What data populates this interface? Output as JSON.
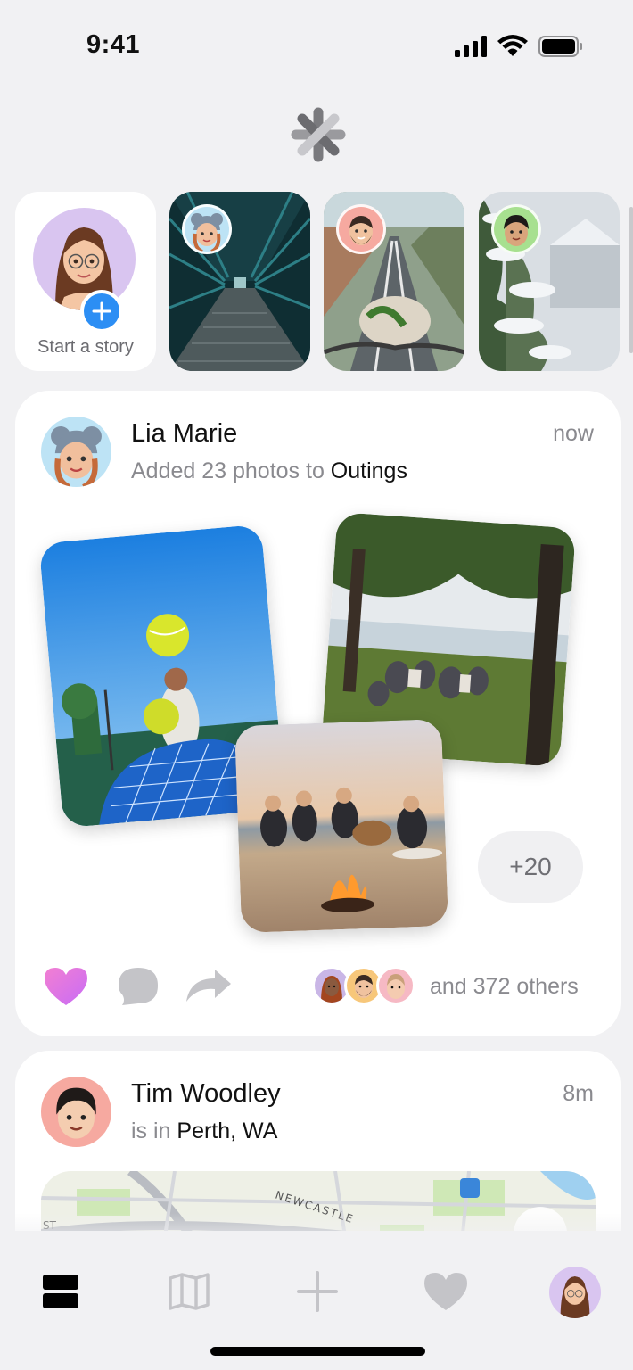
{
  "status_bar": {
    "time": "9:41"
  },
  "stories": {
    "start_label": "Start a story"
  },
  "posts": [
    {
      "name": "Lia Marie",
      "action_text": "Added 23 photos to ",
      "target": "Outings",
      "time": "now",
      "more_count": "+20",
      "likes_text": "and 372 others"
    },
    {
      "name": "Tim Woodley",
      "action_text": "is in ",
      "target": "Perth, WA",
      "time": "8m",
      "map_labels": [
        "NEWCASTLE",
        "ST"
      ]
    }
  ],
  "tabs": [
    "feed-icon",
    "map-icon",
    "add-icon",
    "heart-icon",
    "profile-avatar"
  ],
  "colors": {
    "accent": "#2c8ef4",
    "heart_gradient_start": "#f27fd2",
    "heart_gradient_end": "#c86cf6",
    "muted_text": "#8a8a8f",
    "background": "#f1f1f3"
  }
}
